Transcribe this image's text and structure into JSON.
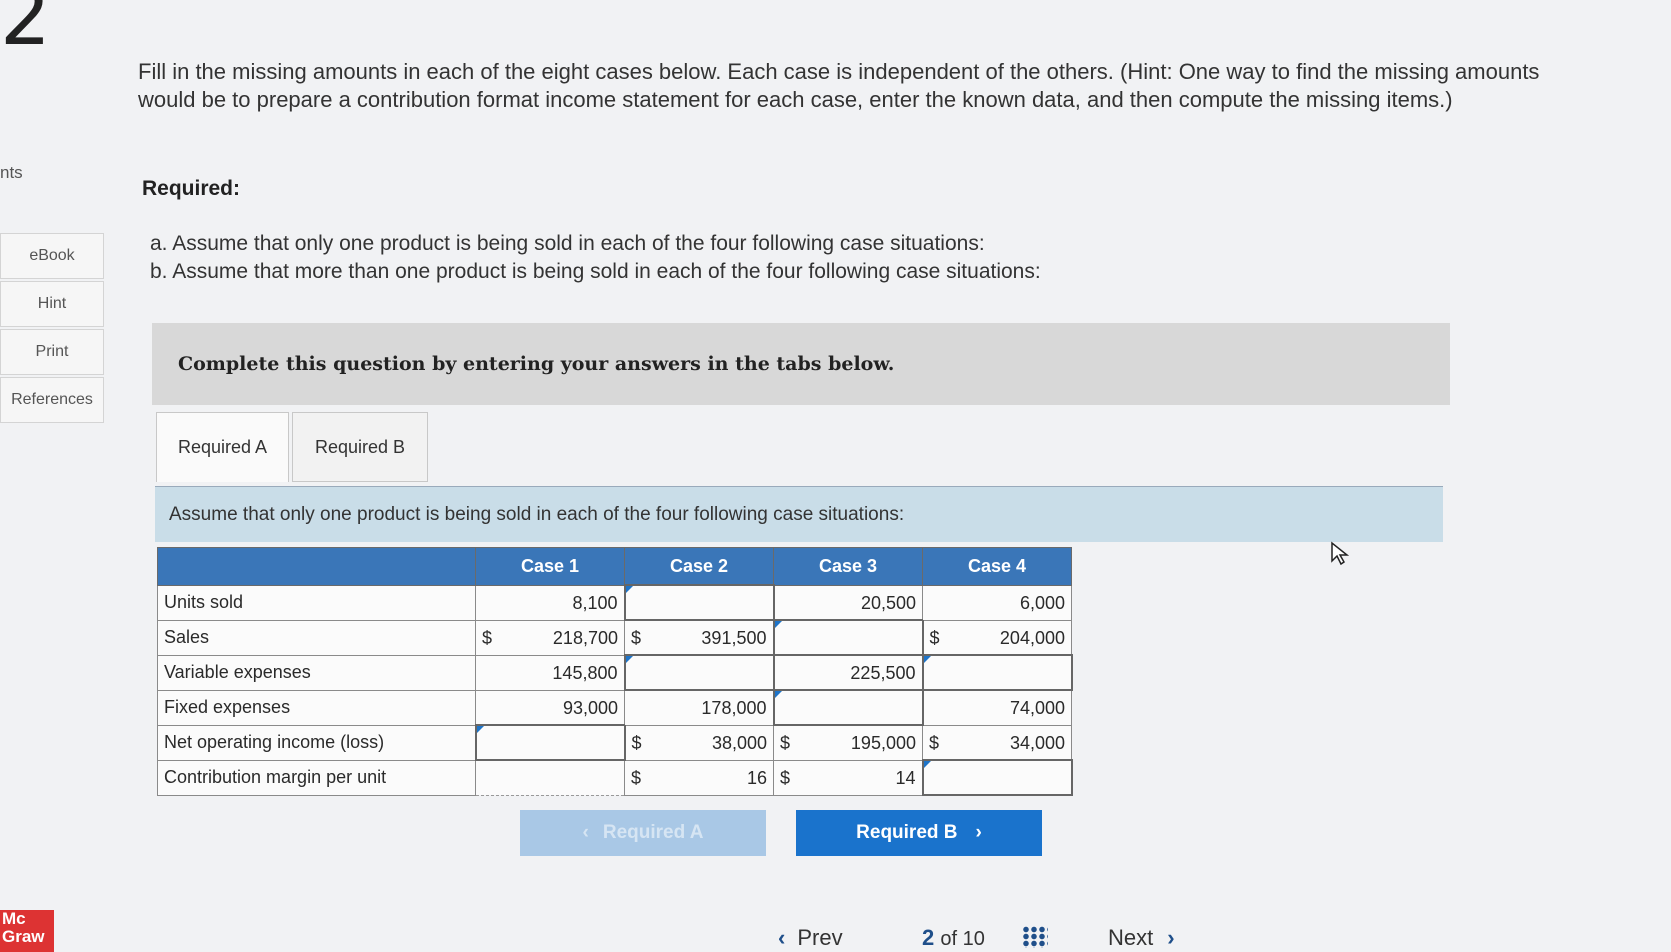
{
  "question_number": "2",
  "sidebar": {
    "partial_label": "nts",
    "items": [
      {
        "label": "eBook"
      },
      {
        "label": "Hint"
      },
      {
        "label": "Print"
      },
      {
        "label": "References"
      }
    ],
    "logo": "Mc Graw"
  },
  "intro_text": "Fill in the missing amounts in each of the eight cases below. Each case is independent of the others. (Hint: One way to find the missing amounts would be to prepare a contribution format income statement for each case, enter the known data, and then compute the missing items.)",
  "required_heading": "Required:",
  "required_items": {
    "a": "a. Assume that only one product is being sold in each of the four following case situations:",
    "b": "b. Assume that more than one product is being sold in each of the four following case situations:"
  },
  "complete_box": "Complete this question by entering your answers in the tabs below.",
  "tabs": [
    {
      "label": "Required A"
    },
    {
      "label": "Required B"
    }
  ],
  "assume_text": "Assume that only one product is being sold in each of the four following case situations:",
  "table": {
    "headers": [
      "",
      "Case 1",
      "Case 2",
      "Case 3",
      "Case 4"
    ],
    "rows": [
      {
        "label": "Units sold",
        "cells": [
          {
            "cur": "",
            "val": "8,100"
          },
          {
            "cur": "",
            "val": ""
          },
          {
            "cur": "",
            "val": "20,500"
          },
          {
            "cur": "",
            "val": "6,000"
          }
        ]
      },
      {
        "label": "Sales",
        "cells": [
          {
            "cur": "$",
            "val": "218,700"
          },
          {
            "cur": "$",
            "val": "391,500"
          },
          {
            "cur": "",
            "val": ""
          },
          {
            "cur": "$",
            "val": "204,000"
          }
        ]
      },
      {
        "label": "Variable expenses",
        "cells": [
          {
            "cur": "",
            "val": "145,800"
          },
          {
            "cur": "",
            "val": ""
          },
          {
            "cur": "",
            "val": "225,500"
          },
          {
            "cur": "",
            "val": ""
          }
        ]
      },
      {
        "label": "Fixed expenses",
        "cells": [
          {
            "cur": "",
            "val": "93,000"
          },
          {
            "cur": "",
            "val": "178,000"
          },
          {
            "cur": "",
            "val": ""
          },
          {
            "cur": "",
            "val": "74,000"
          }
        ]
      },
      {
        "label": "Net operating income (loss)",
        "cells": [
          {
            "cur": "",
            "val": ""
          },
          {
            "cur": "$",
            "val": "38,000"
          },
          {
            "cur": "$",
            "val": "195,000"
          },
          {
            "cur": "$",
            "val": "34,000"
          }
        ]
      },
      {
        "label": "Contribution margin per unit",
        "cells": [
          {
            "cur": "",
            "val": ""
          },
          {
            "cur": "$",
            "val": "16"
          },
          {
            "cur": "$",
            "val": "14"
          },
          {
            "cur": "",
            "val": ""
          }
        ]
      }
    ]
  },
  "buttons": {
    "prev_label": "Required A",
    "next_label": "Required B"
  },
  "pager": {
    "prev": "Prev",
    "page": "2",
    "of": "of 10",
    "next": "Next"
  }
}
